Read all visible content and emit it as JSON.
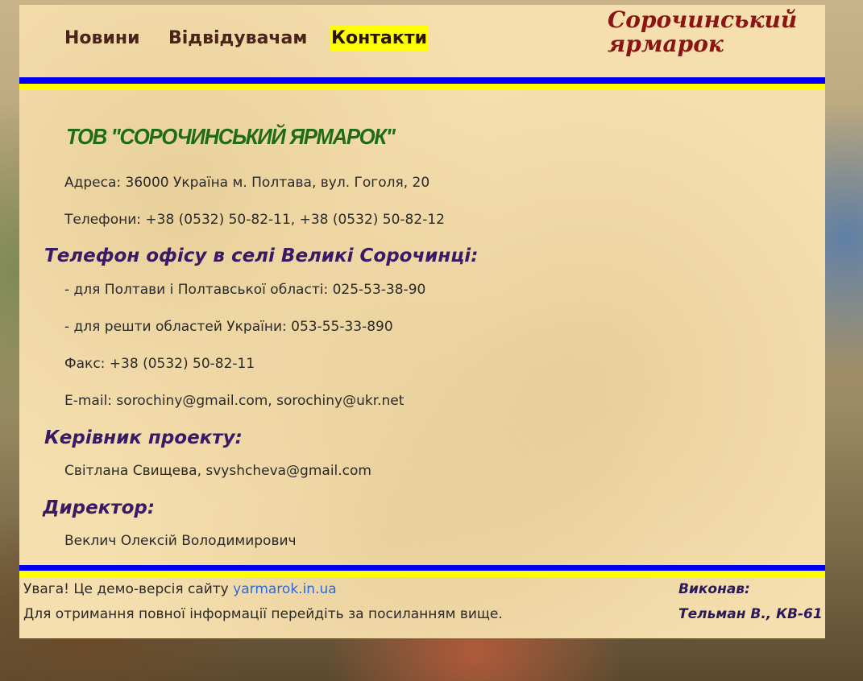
{
  "nav": {
    "items": [
      {
        "label": "Новини"
      },
      {
        "label": "Відвідувачам"
      },
      {
        "label": "Контакти",
        "active": true
      }
    ],
    "site_title_line1": "Сорочинський",
    "site_title_line2": "ярмарок"
  },
  "contacts": {
    "company": "ТОВ \"СОРОЧИНСЬКИЙ ЯРМАРОК\"",
    "address": "Адреса: 36000 Україна м. Полтава, вул. Гоголя, 20",
    "phones": "Телефони: +38 (0532) 50-82-11, +38 (0532) 50-82-12",
    "office_heading": "Телефон офісу в селі Великі Сорочинці:",
    "office_poltava": "- для Полтави і Полтавської області: 025-53-38-90",
    "office_other": "- для решти областей України: 053-55-33-890",
    "fax": "Факс: +38 (0532) 50-82-11",
    "email": "E-mail: sorochiny@gmail.com, sorochiny@ukr.net",
    "manager_heading": "Керівник проекту:",
    "manager": "Світлана Свищева, svyshcheva@gmail.com",
    "director_heading": "Директор:",
    "director": "Веклич Олексій Володимирович"
  },
  "footer": {
    "warning_prefix": "Увага! Це демо-версія сайту ",
    "link_text": "yarmarok.in.ua",
    "note": "Для отримання повної інформації перейдіть за посиланням вище.",
    "author_label": "Виконав:",
    "author_name": "Тельман В., КВ-61"
  },
  "colors": {
    "page_bg": "#f5dfae",
    "stripe_blue": "#0000ee",
    "stripe_yellow": "#ffff00",
    "title": "#8b1414",
    "heading": "#3a1a66",
    "company": "#1f6b18",
    "link": "#2a6ad8"
  }
}
